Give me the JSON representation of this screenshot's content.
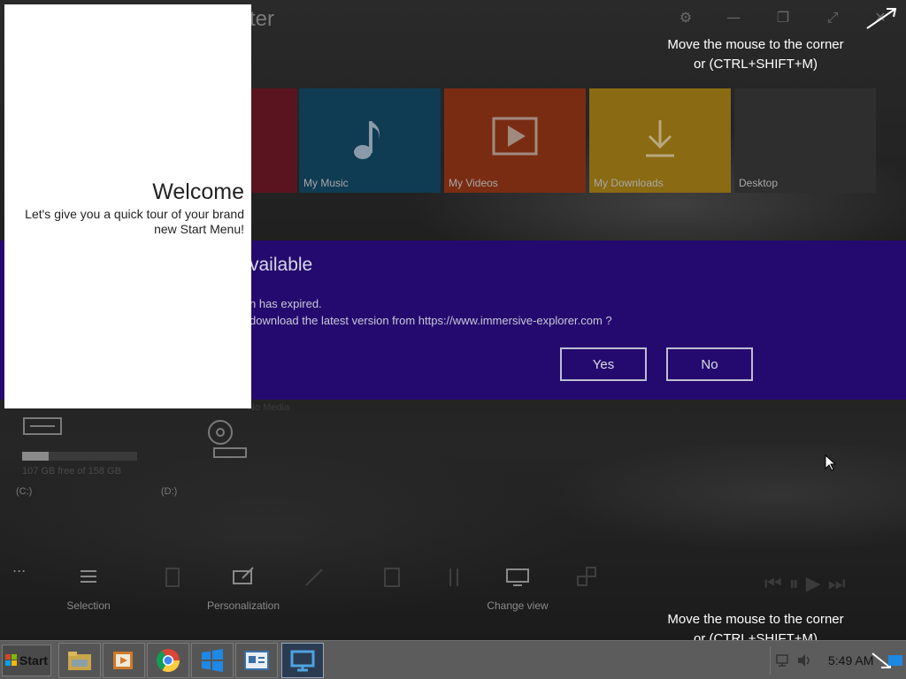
{
  "app": {
    "title_partial": "ter",
    "tiles": [
      {
        "label": "My Music",
        "color": "#0f3b53",
        "icon": "music-note-icon"
      },
      {
        "label": "My Videos",
        "color": "#7a2c13",
        "icon": "play-icon"
      },
      {
        "label": "My Downloads",
        "color": "#8a6a12",
        "icon": "download-icon"
      },
      {
        "label": "Desktop",
        "color": "#2e2e2e",
        "icon": ""
      }
    ],
    "drives": {
      "c_free": "107 GB free of 158 GB",
      "c_label": "(C:)",
      "c_used_fraction": 0.23,
      "d_label": "(D:)",
      "no_media": "No Media"
    },
    "toolbar": {
      "more": "...",
      "items": [
        "Selection",
        "Personalization",
        "Change view"
      ]
    }
  },
  "update_dialog": {
    "title_partial": "vailable",
    "line1": "n has expired.",
    "line2": "download the latest version from https://www.immersive-explorer.com ?",
    "yes": "Yes",
    "no": "No"
  },
  "welcome": {
    "title": "Welcome",
    "text": "Let's give you a quick tour of your brand new Start Menu!"
  },
  "hints": {
    "top_line1": "Move the mouse to the corner",
    "top_line2": "or (CTRL+SHIFT+M)",
    "bottom_line1": "Move the mouse to the corner",
    "bottom_line2": "or (CTRL+SHIFT+M)"
  },
  "taskbar": {
    "start_label": "Start",
    "clock": "5:49 AM",
    "apps": [
      "file-explorer-icon",
      "media-player-icon",
      "chrome-icon",
      "windows-icon",
      "control-panel-icon",
      "desktop-icon"
    ]
  },
  "colors": {
    "update_band": "#240a6e",
    "welcome_bg": "#ffffff",
    "taskbar": "#5c5c5c"
  }
}
